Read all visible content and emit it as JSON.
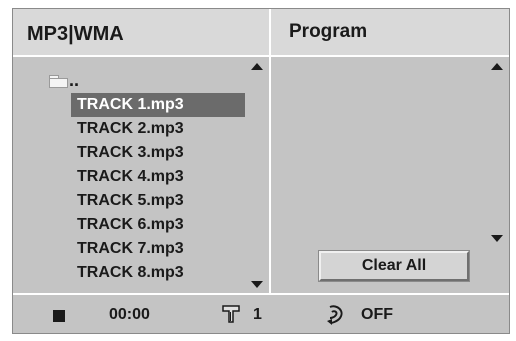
{
  "header": {
    "left_title": "MP3|WMA",
    "right_title": "Program"
  },
  "file_list": {
    "parent_folder_label": "..",
    "selected_index": 0,
    "tracks": [
      "TRACK 1.mp3",
      "TRACK 2.mp3",
      "TRACK 3.mp3",
      "TRACK 4.mp3",
      "TRACK 5.mp3",
      "TRACK 6.mp3",
      "TRACK 7.mp3",
      "TRACK 8.mp3"
    ]
  },
  "program": {
    "clear_all_label": "Clear All"
  },
  "status_bar": {
    "playback_state_icon": "stop-icon",
    "time": "00:00",
    "title_icon": "title-icon",
    "title_number": "1",
    "repeat_icon": "repeat-icon",
    "repeat_mode": "OFF"
  },
  "colors": {
    "panel_bg": "#c4c4c4",
    "header_bg": "#d9d9d9",
    "selected_bg": "#6b6b6b",
    "selected_text": "#ffffff",
    "divider": "#ffffff"
  }
}
